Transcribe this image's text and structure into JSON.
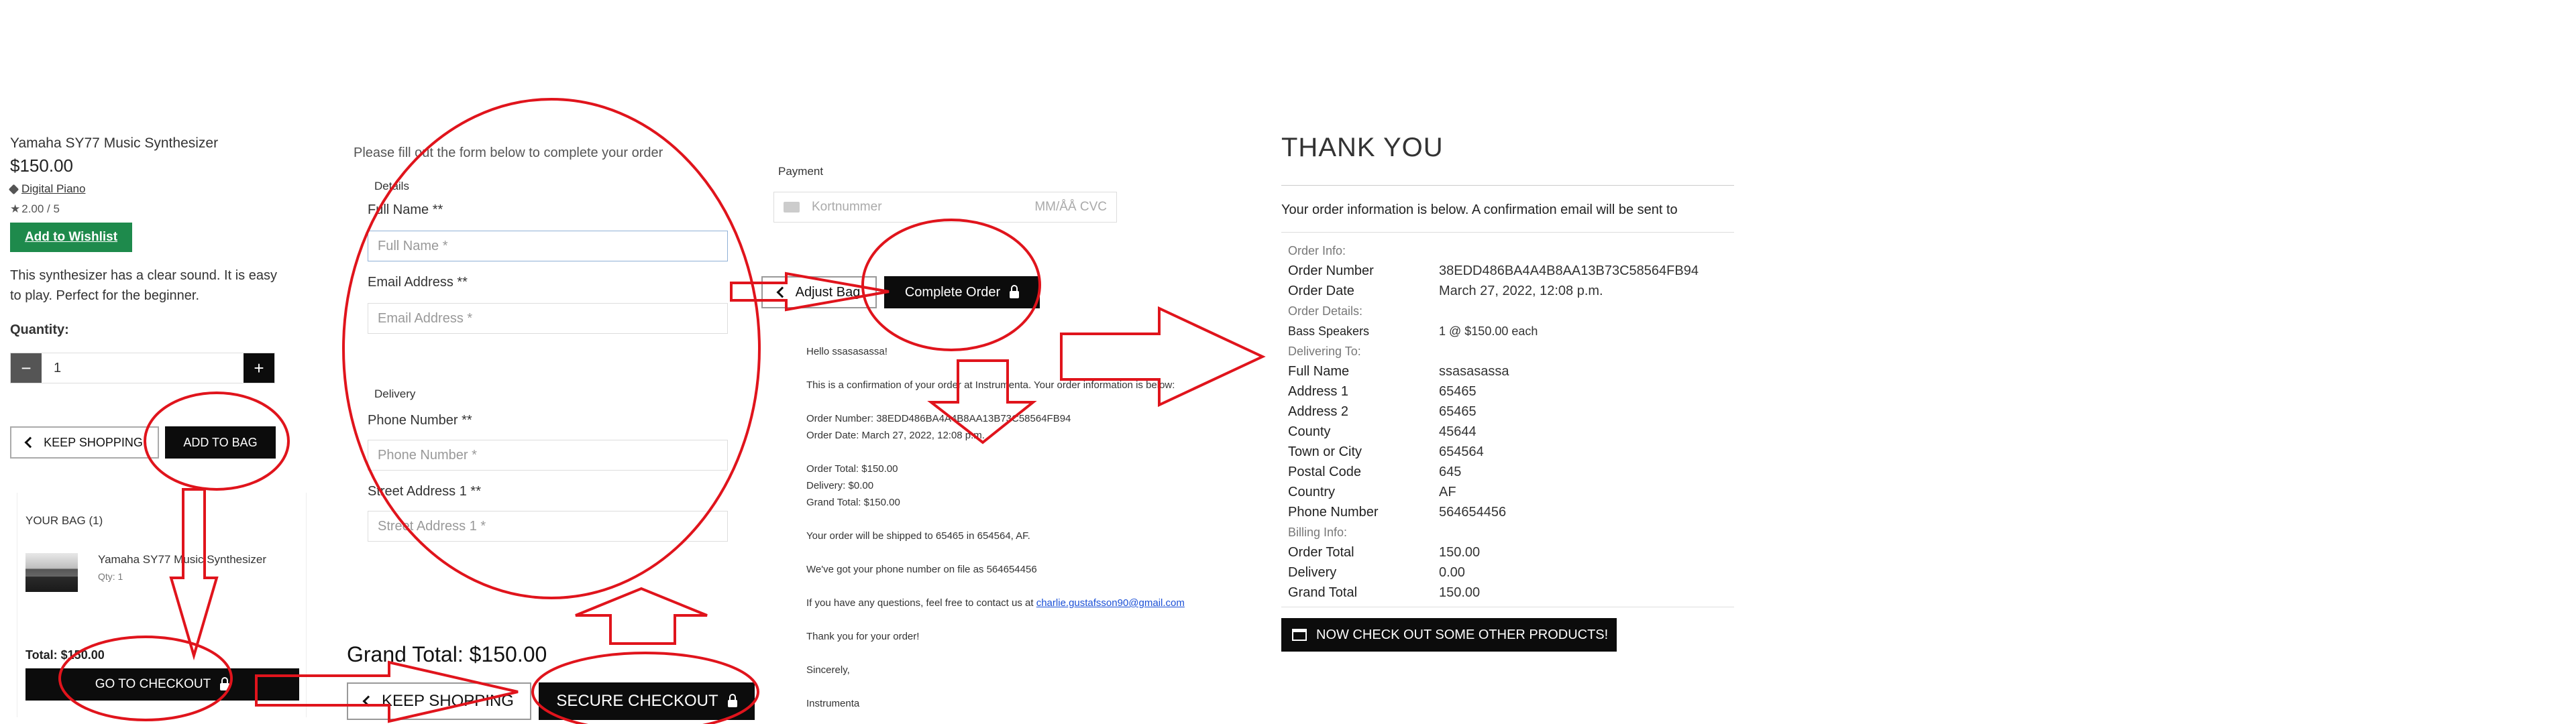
{
  "product": {
    "name": "Yamaha SY77 Music Synthesizer",
    "price": "$150.00",
    "category": "Digital Piano",
    "rating": "2.00 / 5",
    "wishlist_label": "Add to Wishlist",
    "description": "This synthesizer has a clear sound. It is easy to play. Perfect for the beginner.",
    "quantity_label": "Quantity:",
    "quantity_value": "1",
    "minus_label": "−",
    "plus_label": "+",
    "keep_shopping_label": "KEEP SHOPPING",
    "add_to_bag_label": "ADD TO BAG"
  },
  "bag_preview": {
    "title": "YOUR BAG (1)",
    "item_name": "Yamaha SY77 Music Synthesizer",
    "item_qty": "Qty: 1",
    "total": "Total: $150.00",
    "checkout_label": "GO TO CHECKOUT"
  },
  "checkout_form": {
    "intro": "Please fill out the form below to complete your order",
    "details_legend": "Details",
    "full_name_label": "Full Name **",
    "full_name_placeholder": "Full Name *",
    "email_label": "Email Address **",
    "email_placeholder": "Email Address *",
    "delivery_legend": "Delivery",
    "phone_label": "Phone Number **",
    "phone_placeholder": "Phone Number *",
    "street_label": "Street Address 1 **",
    "street_placeholder": "Street Address 1 *",
    "grand_total": "Grand Total: $150.00",
    "keep_shopping_label": "KEEP SHOPPING",
    "secure_checkout_label": "SECURE CHECKOUT"
  },
  "payment": {
    "legend": "Payment",
    "card_placeholder": "Kortnummer",
    "expiry_cvc_placeholder": "MM/ÅÅ CVC",
    "adjust_bag_label": "Adjust Bag",
    "complete_order_label": "Complete Order"
  },
  "email": {
    "greeting": "Hello ssasasassa!",
    "line1": "This is a confirmation of your order at Instrumenta. Your order information is below:",
    "order_number": "Order Number: 38EDD486BA4A4B8AA13B73C58564FB94",
    "order_date": "Order Date: March 27, 2022, 12:08 p.m.",
    "order_total": "Order Total: $150.00",
    "delivery": "Delivery: $0.00",
    "grand_total": "Grand Total: $150.00",
    "shipping": "Your order will be shipped to 65465 in 654564, AF.",
    "phone": "We've got your phone number on file as 564654456",
    "questions_prefix": "If you have any questions, feel free to contact us at",
    "contact_email": "charlie.gustafsson90@gmail.com",
    "thanks": "Thank you for your order!",
    "sign_off": "Sincerely,",
    "signature": "Instrumenta"
  },
  "receipt": {
    "title": "THANK YOU",
    "intro": "Your order information is below. A confirmation email will be sent to",
    "order_info_heading": "Order Info:",
    "order_number_label": "Order Number",
    "order_number": "38EDD486BA4A4B8AA13B73C58564FB94",
    "order_date_label": "Order Date",
    "order_date": "March 27, 2022, 12:08 p.m.",
    "order_details_heading": "Order Details:",
    "item_name": "Bass Speakers",
    "item_detail": "1 @ $150.00 each",
    "delivering_heading": "Delivering To:",
    "delivery_rows": [
      {
        "label": "Full Name",
        "value": "ssasasassa"
      },
      {
        "label": "Address 1",
        "value": "65465"
      },
      {
        "label": "Address 2",
        "value": "65465"
      },
      {
        "label": "County",
        "value": "45644"
      },
      {
        "label": "Town or City",
        "value": "654564"
      },
      {
        "label": "Postal Code",
        "value": "645"
      },
      {
        "label": "Country",
        "value": "AF"
      },
      {
        "label": "Phone Number",
        "value": "564654456"
      }
    ],
    "billing_heading": "Billing Info:",
    "billing_rows": [
      {
        "label": "Order Total",
        "value": "150.00"
      },
      {
        "label": "Delivery",
        "value": "0.00"
      },
      {
        "label": "Grand Total",
        "value": "150.00"
      }
    ],
    "cta_label": "NOW CHECK OUT SOME OTHER PRODUCTS!"
  },
  "colors": {
    "annotation_red": "#e0141c",
    "wishlist_green": "#1e8a4c",
    "button_black": "#0c0c0c"
  }
}
